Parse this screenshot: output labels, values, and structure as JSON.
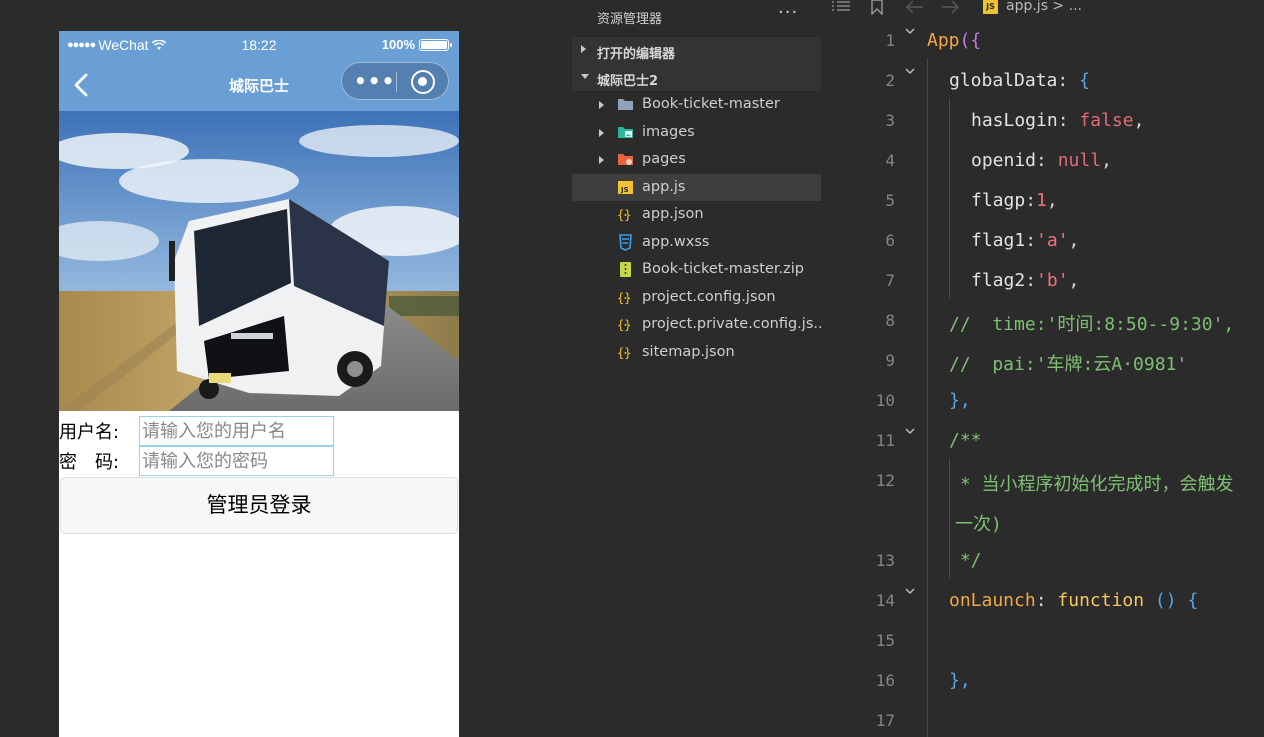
{
  "simulator": {
    "status_bar": {
      "signal_dots": "●●●●●",
      "carrier": "WeChat",
      "time": "18:22",
      "battery_text": "100%",
      "battery_level": 1.0
    },
    "nav": {
      "title": "城际巴士",
      "more_glyph": "•••"
    },
    "form": {
      "username_label": "用户名:",
      "username_placeholder": "请输入您的用户名",
      "password_label": "密　码:",
      "password_placeholder": "请输入您的密码",
      "login_button": "管理员登录"
    },
    "colors": {
      "nav_bg": "#6a9fd6",
      "input_border": "#9ad0e8"
    }
  },
  "explorer": {
    "title": "资源管理器",
    "more": "···",
    "open_editors_label": "打开的编辑器",
    "project_label": "城际巴士2",
    "items": [
      {
        "name": "Book-ticket-master",
        "icon": "folder-icon",
        "has_caret": true,
        "active": false
      },
      {
        "name": "images",
        "icon": "images-folder-icon",
        "has_caret": true,
        "active": false
      },
      {
        "name": "pages",
        "icon": "pages-folder-icon",
        "has_caret": true,
        "active": false
      },
      {
        "name": "app.js",
        "icon": "js-file-icon",
        "has_caret": false,
        "active": true
      },
      {
        "name": "app.json",
        "icon": "json-file-icon",
        "has_caret": false,
        "active": false
      },
      {
        "name": "app.wxss",
        "icon": "css-file-icon",
        "has_caret": false,
        "active": false
      },
      {
        "name": "Book-ticket-master.zip",
        "icon": "zip-file-icon",
        "has_caret": false,
        "active": false
      },
      {
        "name": "project.config.json",
        "icon": "json-file-icon",
        "has_caret": false,
        "active": false
      },
      {
        "name": "project.private.config.js...",
        "icon": "json-file-icon",
        "has_caret": false,
        "active": false
      },
      {
        "name": "sitemap.json",
        "icon": "json-file-icon",
        "has_caret": false,
        "active": false
      }
    ]
  },
  "editor": {
    "breadcrumb": {
      "file_badge": "JS",
      "file": "app.js > ..."
    },
    "line_numbers": [
      "1",
      "2",
      "3",
      "4",
      "5",
      "6",
      "7",
      "8",
      "9",
      "10",
      "11",
      "12",
      "13",
      "14",
      "15",
      "16",
      "17"
    ],
    "code": {
      "l1_fn": "App",
      "l1_open": "({",
      "l2_prop": "globalData",
      "l2_rest": ": ",
      "l2_brace": "{",
      "l3_prop": "hasLogin",
      "l3_colon": ": ",
      "l3_val": "false",
      "l3_comma": ",",
      "l4_prop": "openid",
      "l4_colon": ": ",
      "l4_val": "null",
      "l4_comma": ",",
      "l5_prop": "flagp",
      "l5_colon": ":",
      "l5_val": "1",
      "l5_comma": ",",
      "l6_prop": "flag1",
      "l6_colon": ":",
      "l6_val": "'a'",
      "l6_comma": ",",
      "l7_prop": "flag2",
      "l7_colon": ":",
      "l7_val": "'b'",
      "l7_comma": ",",
      "l8": "//  time:'时间:8:50--9:30',",
      "l9": "//  pai:'车牌:云A·0981'",
      "l10": "},",
      "l11": "/**",
      "l12a": " * 当小程序初始化完成时，会触发",
      "l12b": "一次)",
      "l13": " */",
      "l14_fn": "onLaunch",
      "l14_colon": ": ",
      "l14_kw": "function",
      "l14_paren": " () ",
      "l14_brace": "{",
      "l16": "},"
    }
  }
}
